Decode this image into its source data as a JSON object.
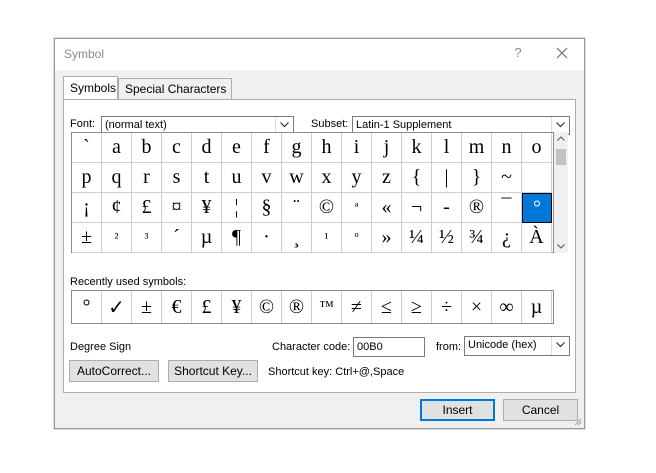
{
  "window": {
    "title": "Symbol",
    "help": "?"
  },
  "tabs": [
    {
      "label": "Symbols",
      "active": true
    },
    {
      "label": "Special Characters",
      "active": false
    }
  ],
  "font": {
    "label": "Font:",
    "value": "(normal text)"
  },
  "subset": {
    "label": "Subset:",
    "value": "Latin-1 Supplement"
  },
  "symbols": [
    "`",
    "a",
    "b",
    "c",
    "d",
    "e",
    "f",
    "g",
    "h",
    "i",
    "j",
    "k",
    "l",
    "m",
    "n",
    "o",
    "p",
    "q",
    "r",
    "s",
    "t",
    "u",
    "v",
    "w",
    "x",
    "y",
    "z",
    "{",
    "|",
    "}",
    "~",
    "",
    "¡",
    "¢",
    "£",
    "¤",
    "¥",
    "¦",
    "§",
    "¨",
    "©",
    "ª",
    "«",
    "¬",
    "-",
    "®",
    "¯",
    "°",
    "±",
    "²",
    "³",
    "´",
    "µ",
    "¶",
    "·",
    "¸",
    "¹",
    "º",
    "»",
    "¼",
    "½",
    "¾",
    "¿",
    "À"
  ],
  "selected_index": 47,
  "recent": {
    "label": "Recently used symbols:",
    "items": [
      "°",
      "✓",
      "±",
      "€",
      "£",
      "¥",
      "©",
      "®",
      "™",
      "≠",
      "≤",
      "≥",
      "÷",
      "×",
      "∞",
      "µ"
    ]
  },
  "character_name": "Degree Sign",
  "character_code": {
    "label": "Character code:",
    "value": "00B0"
  },
  "from": {
    "label": "from:",
    "value": "Unicode (hex)"
  },
  "buttons": {
    "autocorrect": "AutoCorrect...",
    "shortcut_key": "Shortcut Key...",
    "insert": "Insert",
    "cancel": "Cancel"
  },
  "shortcut_text": "Shortcut key: Ctrl+@,Space",
  "colors": {
    "selection": "#0078d7",
    "dialog_bg": "#f0f0f0"
  }
}
